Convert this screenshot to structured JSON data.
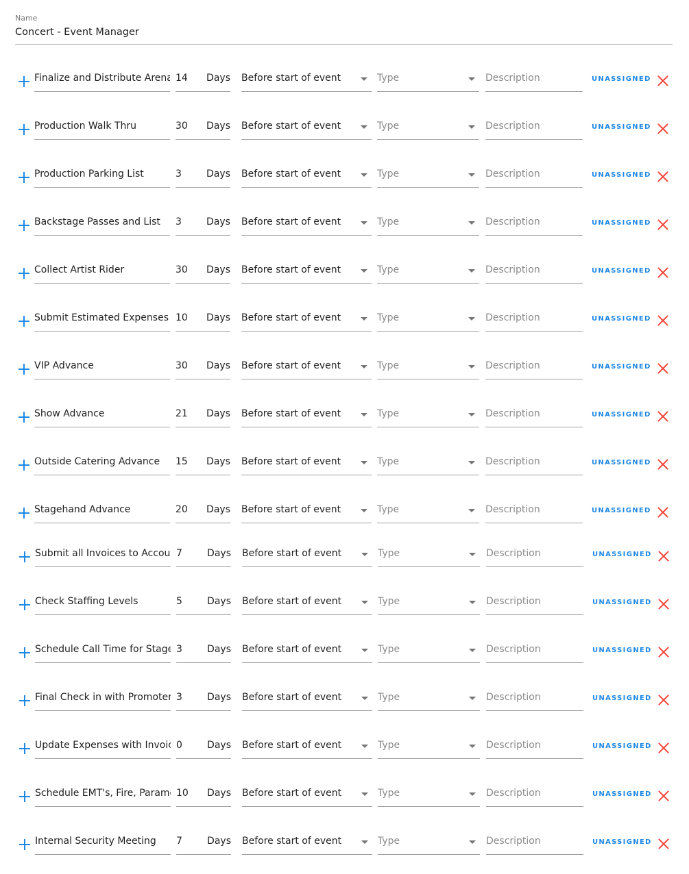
{
  "name_field": {
    "label": "Name",
    "value": "Concert - Event Manager"
  },
  "days_unit": "Days",
  "type_placeholder": "Type",
  "description_placeholder": "Description",
  "assign_label": "UNASSIGNED",
  "icons": {
    "add": "plus-icon",
    "remove": "close-icon",
    "dropdown": "caret-down-icon"
  },
  "colors": {
    "accent": "#1e88e5",
    "danger": "#f44336"
  },
  "tasks": [
    {
      "name": "Finalize and Distribute Arena Ad",
      "days": "14",
      "when": "Before start of event"
    },
    {
      "name": "Production Walk Thru",
      "days": "30",
      "when": "Before start of event"
    },
    {
      "name": "Production Parking List",
      "days": "3",
      "when": "Before start of event"
    },
    {
      "name": "Backstage Passes and List",
      "days": "3",
      "when": "Before start of event"
    },
    {
      "name": "Collect Artist Rider",
      "days": "30",
      "when": "Before start of event"
    },
    {
      "name": "Submit Estimated Expenses to",
      "days": "10",
      "when": "Before start of event"
    },
    {
      "name": "VIP Advance",
      "days": "30",
      "when": "Before start of event"
    },
    {
      "name": "Show Advance",
      "days": "21",
      "when": "Before start of event"
    },
    {
      "name": "Outside Catering Advance",
      "days": "15",
      "when": "Before start of event"
    },
    {
      "name": "Stagehand Advance",
      "days": "20",
      "when": "Before start of event"
    },
    {
      "name": "Submit all Invoices to Accounting",
      "days": "7",
      "when": "Before start of event"
    },
    {
      "name": "Check Staffing Levels",
      "days": "5",
      "when": "Before start of event"
    },
    {
      "name": "Schedule Call Time for Stagehands",
      "days": "3",
      "when": "Before start of event"
    },
    {
      "name": "Final Check in with Promoter",
      "days": "3",
      "when": "Before start of event"
    },
    {
      "name": "Update Expenses with Invoices",
      "days": "0",
      "when": "Before start of event"
    },
    {
      "name": "Schedule EMT's, Fire, Paramedics",
      "days": "10",
      "when": "Before start of event"
    },
    {
      "name": "Internal Security Meeting",
      "days": "7",
      "when": "Before start of event"
    }
  ]
}
